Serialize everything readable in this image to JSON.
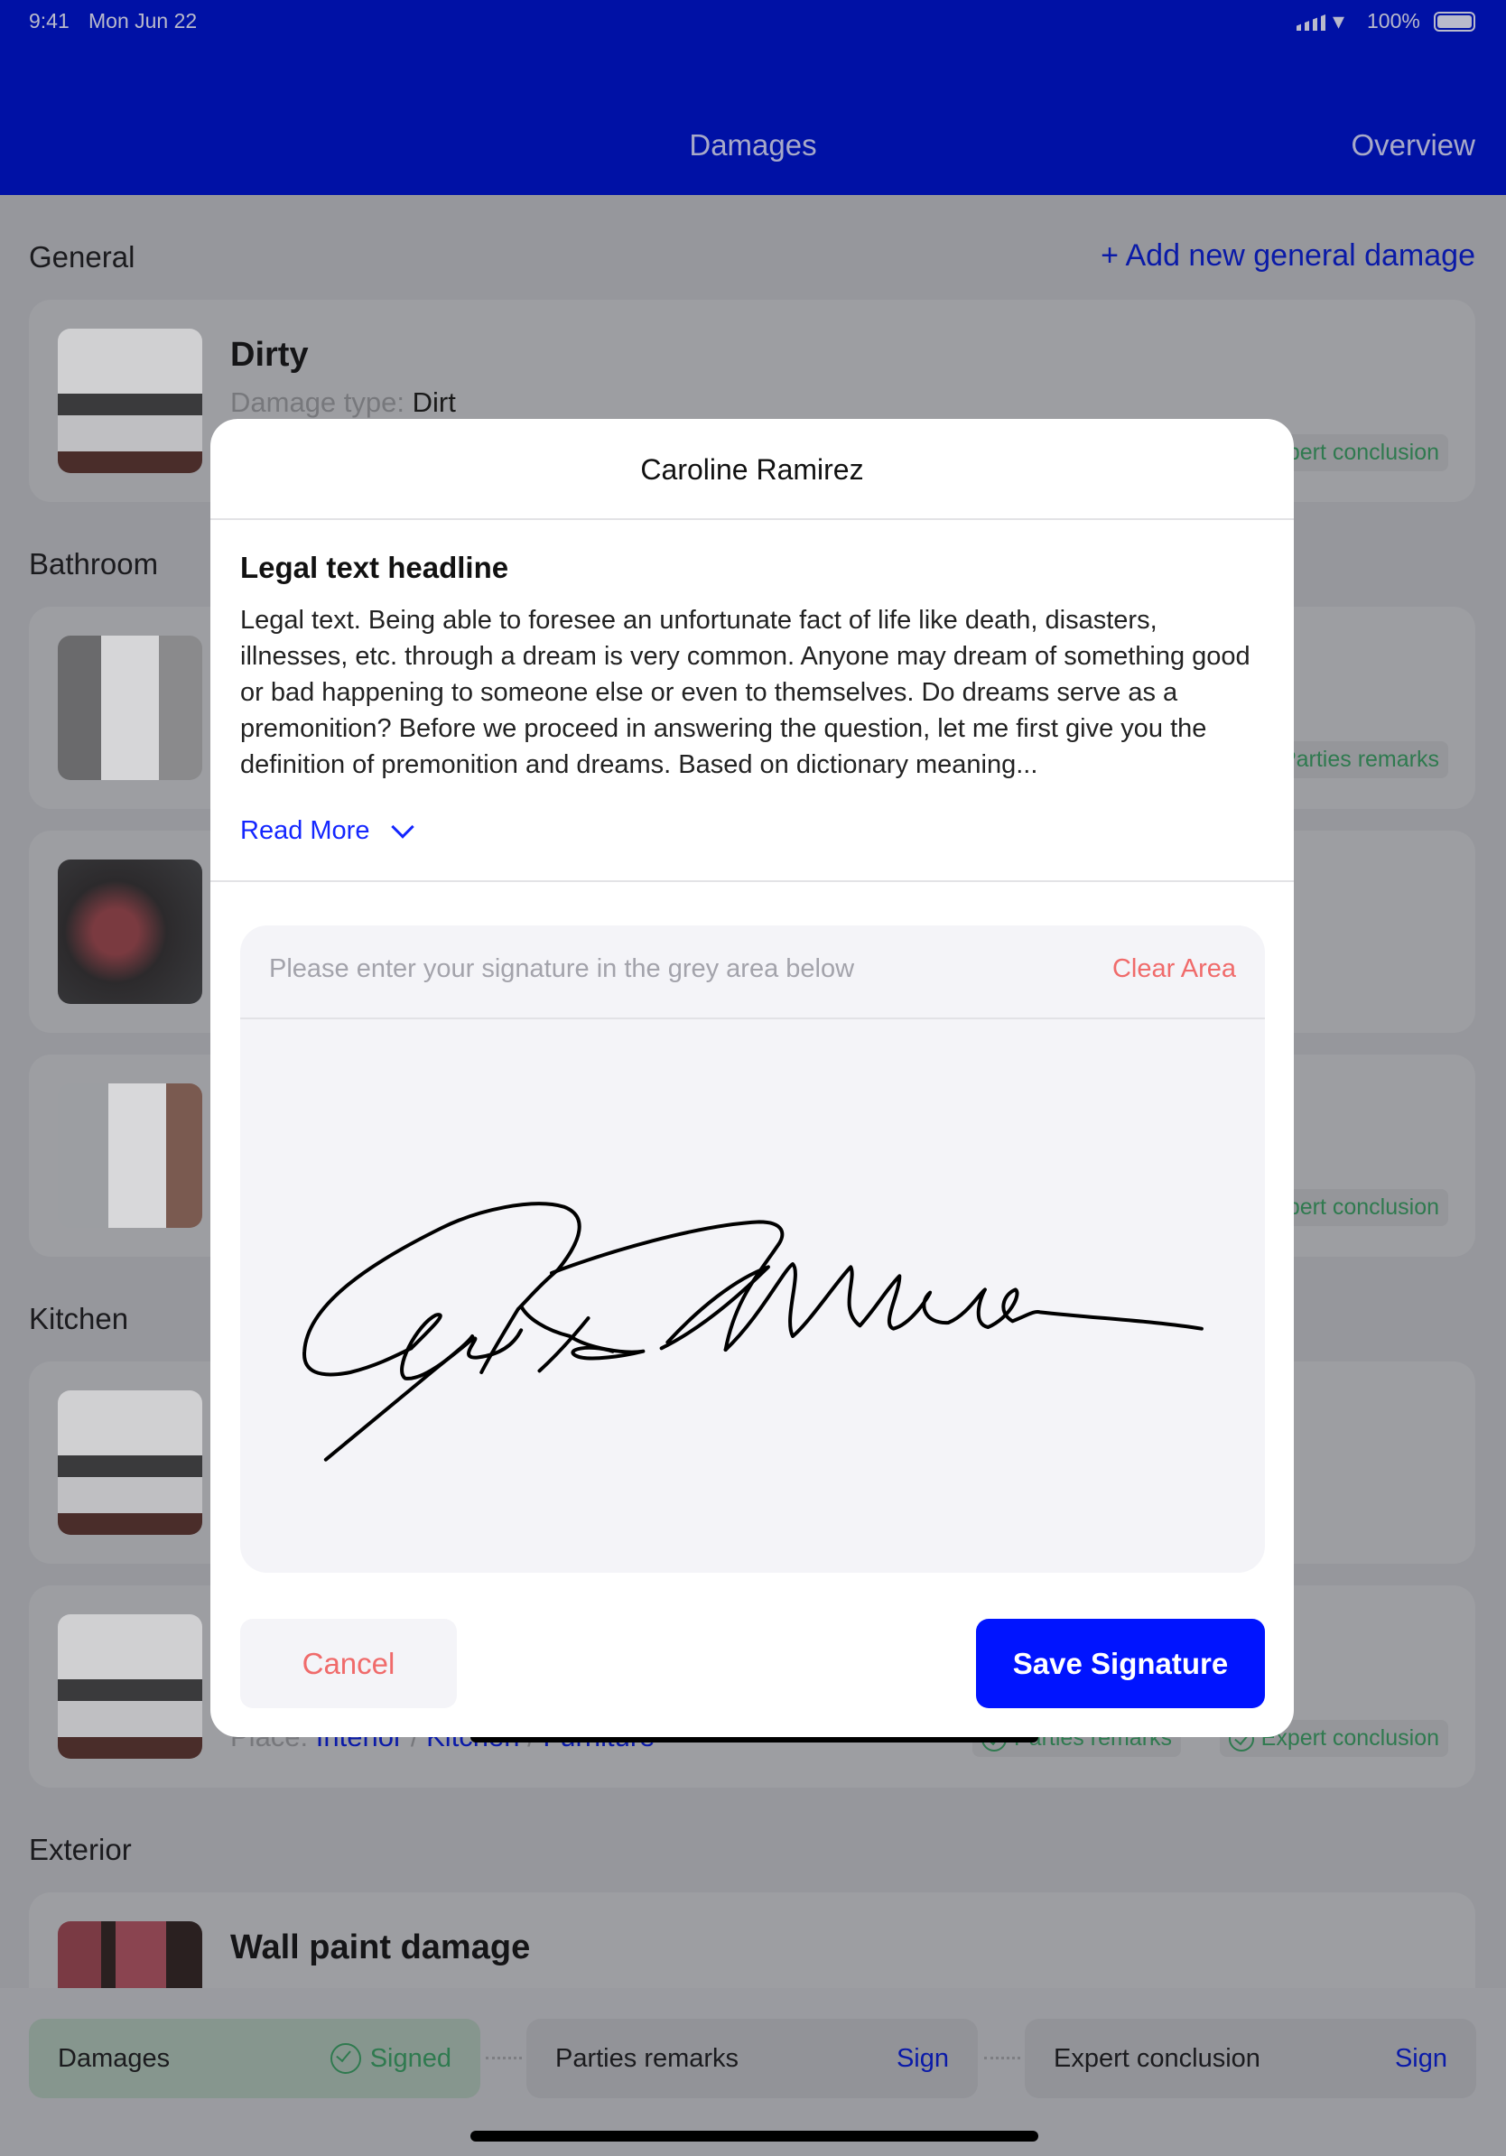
{
  "status_bar": {
    "time": "9:41",
    "date": "Mon Jun 22",
    "battery": "100%"
  },
  "header": {
    "title": "Damages",
    "overview": "Overview",
    "color": "#0011a5"
  },
  "general": {
    "heading": "General",
    "add_link": "+ Add new general damage"
  },
  "sections": {
    "bathroom": "Bathroom",
    "kitchen": "Kitchen",
    "exterior": "Exterior"
  },
  "cards": [
    {
      "title": "Dirty",
      "type_label": "Damage type:",
      "type_value": "Dirt",
      "chip": "Expert conclusion"
    },
    {
      "chip": "Parties remarks"
    },
    {},
    {
      "chip": "Expert conclusion"
    },
    {},
    {
      "place_label": "Place:",
      "place": [
        "Interior",
        "Kitchen",
        "Furniture"
      ],
      "chips": [
        "Parties remarks",
        "Expert conclusion"
      ]
    },
    {
      "title": "Wall paint damage"
    }
  ],
  "bottom_tabs": [
    {
      "label": "Damages",
      "status": "Signed",
      "signed": true
    },
    {
      "label": "Parties remarks",
      "status": "Sign",
      "signed": false
    },
    {
      "label": "Expert conclusion",
      "status": "Sign",
      "signed": false
    }
  ],
  "modal": {
    "title": "Caroline Ramirez",
    "legal_headline": "Legal text headline",
    "legal_text": "Legal text. Being able to foresee an unfortunate fact of life like death, disasters, illnesses, etc. through a dream is very common. Anyone may dream of something good or bad happening to someone else or even to themselves. Do dreams serve as a premonition? Before we proceed in answering the question, let me first give you the definition of premonition and dreams. Based on dictionary meaning...",
    "read_more": "Read More",
    "signature_prompt": "Please enter your signature in the grey area below",
    "clear_area": "Clear Area",
    "cancel": "Cancel",
    "save": "Save Signature",
    "accent": "#0014ff",
    "danger": "#f06b6b"
  }
}
